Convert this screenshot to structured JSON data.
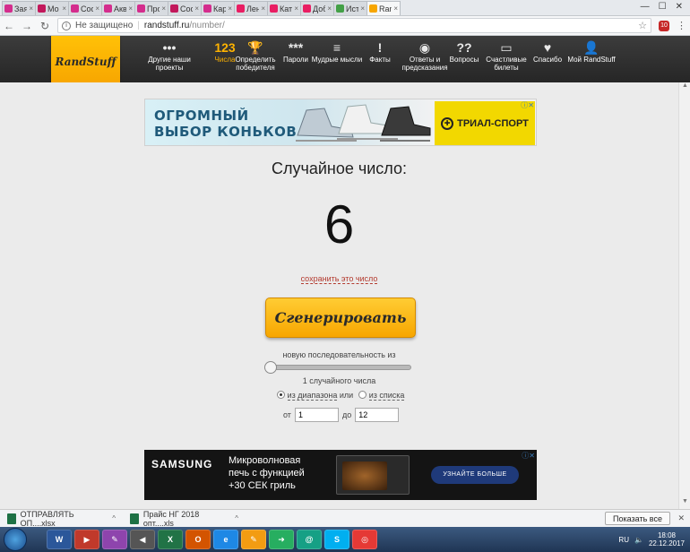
{
  "tabs": [
    {
      "label": "Заявки",
      "color": "#d42d8d"
    },
    {
      "label": "Мо",
      "color": "#c2185b"
    },
    {
      "label": "Сооб",
      "color": "#d42d8d"
    },
    {
      "label": "Аква",
      "color": "#d42d8d"
    },
    {
      "label": "Проф",
      "color": "#d42d8d"
    },
    {
      "label": "Сооб",
      "color": "#c2185b"
    },
    {
      "label": "Карн",
      "color": "#d42d8d"
    },
    {
      "label": "Лент",
      "color": "#e91e63"
    },
    {
      "label": "Кате",
      "color": "#e91e63"
    },
    {
      "label": "Доба",
      "color": "#e91e63"
    },
    {
      "label": "Исто",
      "color": "#43a047"
    },
    {
      "label": "Rand",
      "color": "#f7a600"
    }
  ],
  "browser": {
    "security_label": "Не защищено",
    "url_host": "randstuff.ru",
    "url_path": "/number/",
    "ext_badge": "10"
  },
  "site": {
    "logo": "RandStuff",
    "nav": [
      {
        "icon": "•••",
        "label": "Другие наши проекты",
        "active": false
      },
      {
        "icon": "123",
        "label": "Числа",
        "active": true
      },
      {
        "icon": "🏆",
        "label": "Определить победителя",
        "active": false
      },
      {
        "icon": "***",
        "label": "Пароли",
        "active": false
      },
      {
        "icon": "≡",
        "label": "Мудрые мысли",
        "active": false
      },
      {
        "icon": "!",
        "label": "Факты",
        "active": false
      },
      {
        "icon": "◉",
        "label": "Ответы и предсказания",
        "active": false
      },
      {
        "icon": "??",
        "label": "Вопросы",
        "active": false
      },
      {
        "icon": "▭",
        "label": "Счастливые билеты",
        "active": false
      },
      {
        "icon": "♥",
        "label": "Спасибо",
        "active": false
      },
      {
        "icon": "👤",
        "label": "Мой RandStuff",
        "active": false
      }
    ]
  },
  "ad_top": {
    "line1": "ОГРОМНЫЙ",
    "line2": "ВЫБОР КОНЬКОВ",
    "brand": "ТРИАЛ-СПОРТ"
  },
  "main": {
    "heading": "Случайное число:",
    "number": "6",
    "save_link": "сохранить это число",
    "generate_label": "Сгенерировать",
    "sequence_label": "новую последовательность из",
    "count_text": "1 случайного числа",
    "radio_range": "из диапазона",
    "radio_or": "или",
    "radio_list": "из списка",
    "from_label": "от",
    "from_value": "1",
    "to_label": "до",
    "to_value": "12"
  },
  "ad_bottom": {
    "brand": "SAMSUNG",
    "line1": "Микроволновая",
    "line2": "печь с функцией",
    "line3": "+30 СЕК гриль",
    "cta": "УЗНАЙТЕ БОЛЬШЕ"
  },
  "downloads": [
    {
      "name": "ОТПРАВЛЯТЬ ОП....xlsx"
    },
    {
      "name": "Прайс НГ 2018 опт....xls"
    }
  ],
  "downloads_show_all": "Показать все",
  "taskbar": {
    "apps": [
      "W",
      "▶",
      "✎",
      "◀",
      "X",
      "O",
      "e",
      "✎",
      "➜",
      "@",
      "S",
      "◎"
    ],
    "lang": "RU",
    "time": "18:08",
    "date": "22.12.2017"
  }
}
